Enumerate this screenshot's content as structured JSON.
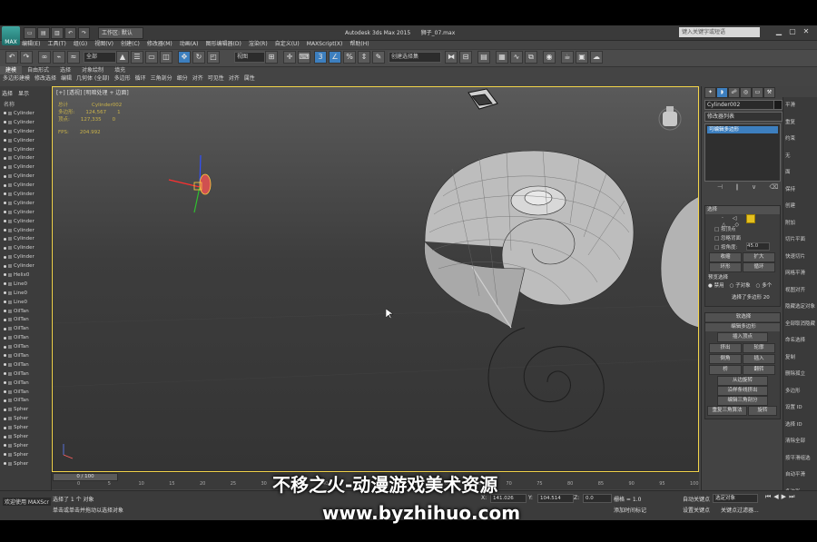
{
  "app": {
    "title": "Autodesk 3ds Max  2015",
    "filename": "狮子_07.max",
    "logo_label": "MAX",
    "workspace_label": "工作区: 默认",
    "search_placeholder": "键入关键字或短语"
  },
  "menu": [
    "编辑(E)",
    "工具(T)",
    "组(G)",
    "视图(V)",
    "创建(C)",
    "修改器(M)",
    "动画(A)",
    "图形编辑器(D)",
    "渲染(R)",
    "自定义(U)",
    "MAXScript(X)",
    "帮助(H)"
  ],
  "toolbar": {
    "selection_filter": "全部",
    "view_dropdown": "视图",
    "named_selection": "创建选择集"
  },
  "ribbon": {
    "tabs": [
      "建模",
      "自由形式",
      "选择",
      "对象绘制",
      "填充"
    ],
    "row": [
      "多边形建模",
      "修改选择",
      "编辑",
      "几何体 (全部)",
      "多边形",
      "循环",
      "三角剖分",
      "细分",
      "对齐",
      "可见性",
      "对齐",
      "属性"
    ]
  },
  "scene_explorer": {
    "tabs": [
      "选择",
      "显示"
    ],
    "header": "名称",
    "items": [
      "Cylinder",
      "Cylinder",
      "Cylinder",
      "Cylinder",
      "Cylinder",
      "Cylinder",
      "Cylinder",
      "Cylinder",
      "Cylinder",
      "Cylinder",
      "Cylinder",
      "Cylinder",
      "Cylinder",
      "Cylinder",
      "Cylinder",
      "Cylinder",
      "Cylinder",
      "Cylinder",
      "Helix0",
      "Line0",
      "Line0",
      "Line0",
      "OilTan",
      "OilTan",
      "OilTan",
      "OilTan",
      "OilTan",
      "OilTan",
      "OilTan",
      "OilTan",
      "OilTan",
      "OilTan",
      "OilTan",
      "Spher",
      "Spher",
      "Spher",
      "Spher",
      "Spher",
      "Spher",
      "Spher"
    ]
  },
  "viewport": {
    "label": "[+] [透视] [明暗处理 + 边面]",
    "stats": {
      "header_left": "总计",
      "header_right": "Cylinder002",
      "polys_label": "多边形:",
      "polys_total": "124,567",
      "polys_sel": "1",
      "verts_label": "顶点:",
      "verts_total": "127,335",
      "verts_sel": "0",
      "fps_label": "FPS:",
      "fps": "204.992"
    }
  },
  "command_panel": {
    "object_name": "Cylinder002",
    "modifier_list": "修改器列表",
    "stack_item": "可编辑多边形",
    "selection_rollout": {
      "title": "选择",
      "by_vertex": "按顶点",
      "ignore_backfacing": "忽略背面",
      "by_angle": "按角度:",
      "angle_value": "45.0",
      "shrink": "收缩",
      "grow": "扩大",
      "ring": "环形",
      "loop": "循环",
      "preview_title": "预览选择",
      "preview_off": "禁用",
      "preview_sub": "子对象",
      "preview_multi": "多个",
      "status": "选择了多边形 20"
    },
    "soft_selection": "软选择",
    "edit_polygons": {
      "title": "编辑多边形",
      "insert_vertex": "插入顶点",
      "extrude": "挤出",
      "outline": "轮廓",
      "bevel": "倒角",
      "inset": "插入",
      "bridge": "桥",
      "flip": "翻转",
      "hinge": "从边旋转",
      "extrude_spline": "沿样条线挤出",
      "edit_tri": "编辑三角剖分",
      "retriangulate": "重复三角算法",
      "turn": "旋转"
    }
  },
  "far_right_panel": {
    "lines": [
      "平滑",
      "重复",
      "约束",
      "无",
      "面",
      "保持",
      "创建",
      "附加",
      "切片平面",
      "快速切片",
      "网格平滑",
      "视图对齐",
      "隐藏选定对象",
      "全部取消隐藏",
      "命名选择",
      "复制",
      "删除孤立",
      "多边形",
      "设置 ID",
      "选择 ID",
      "清除全部",
      "按平滑组选",
      "自动平滑",
      "多边形"
    ]
  },
  "timeline": {
    "slider": "0 / 100",
    "ticks": [
      "0",
      "5",
      "10",
      "15",
      "20",
      "25",
      "30",
      "35",
      "40",
      "45",
      "50",
      "55",
      "60",
      "65",
      "70",
      "75",
      "80",
      "85",
      "90",
      "95",
      "100"
    ]
  },
  "status_bar": {
    "welcome": "欢迎使用 MAXScr",
    "selected": "选择了 1 个 对象",
    "prompt": "单击或单击并拖动以选择对象",
    "x_label": "X:",
    "x_value": "141.026",
    "y_label": "Y:",
    "y_value": "104.514",
    "z_label": "Z:",
    "z_value": "0.0",
    "grid": "栅格 = 1.0",
    "add_time_tag": "添加时间标记",
    "auto_key": "自动关键点",
    "selected_object": "选定对象",
    "set_key": "设置关键点",
    "key_filters": "关键点过滤器..."
  },
  "watermark": {
    "line1": "不移之火-动漫游戏美术资源",
    "line2": "www.byzhihuo.com"
  },
  "colors": {
    "viewport_border": "#f4d54a",
    "accent": "#3d7fbf",
    "stats_text": "#c9b24a"
  }
}
